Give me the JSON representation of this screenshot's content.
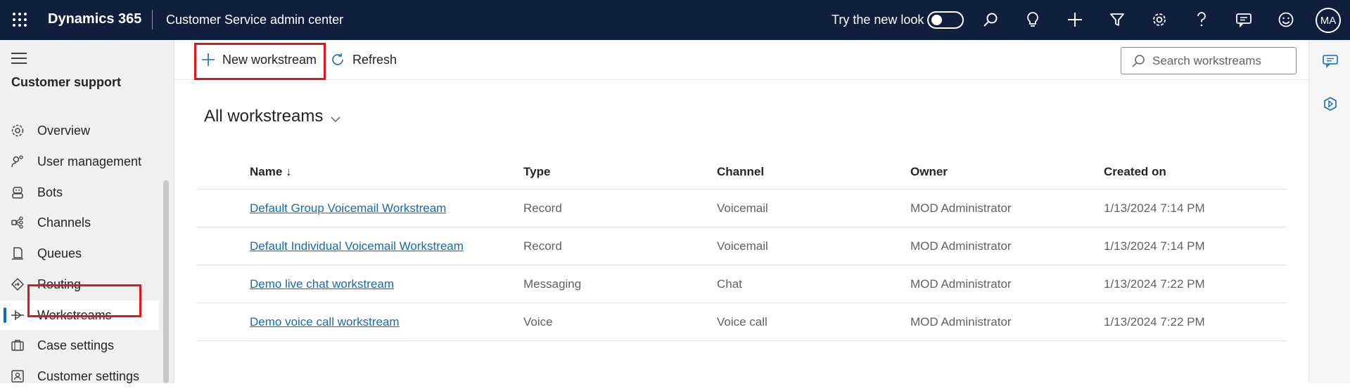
{
  "topbar": {
    "brand": "Dynamics 365",
    "app_title": "Customer Service admin center",
    "try_new_look": "Try the new look",
    "avatar_initials": "MA",
    "background": "#0f1f3d"
  },
  "sidebar": {
    "section_title": "Customer support",
    "items": [
      {
        "label": "Overview",
        "icon": "overview-icon"
      },
      {
        "label": "User management",
        "icon": "user-management-icon"
      },
      {
        "label": "Bots",
        "icon": "bot-icon"
      },
      {
        "label": "Channels",
        "icon": "channels-icon"
      },
      {
        "label": "Queues",
        "icon": "queues-icon"
      },
      {
        "label": "Routing",
        "icon": "routing-icon"
      },
      {
        "label": "Workstreams",
        "icon": "workstreams-icon",
        "selected": true
      },
      {
        "label": "Case settings",
        "icon": "case-settings-icon"
      },
      {
        "label": "Customer settings",
        "icon": "customer-settings-icon"
      }
    ]
  },
  "commandbar": {
    "new_label": "New workstream",
    "refresh_label": "Refresh",
    "search_placeholder": "Search workstreams"
  },
  "view": {
    "title": "All workstreams"
  },
  "grid": {
    "columns": [
      "Name ↓",
      "Type",
      "Channel",
      "Owner",
      "Created on"
    ],
    "rows": [
      {
        "name": "Default Group Voicemail Workstream",
        "type": "Record",
        "channel": "Voicemail",
        "owner": "MOD Administrator",
        "created": "1/13/2024 7:14 PM"
      },
      {
        "name": "Default Individual Voicemail Workstream",
        "type": "Record",
        "channel": "Voicemail",
        "owner": "MOD Administrator",
        "created": "1/13/2024 7:14 PM"
      },
      {
        "name": "Demo live chat workstream",
        "type": "Messaging",
        "channel": "Chat",
        "owner": "MOD Administrator",
        "created": "1/13/2024 7:22 PM"
      },
      {
        "name": "Demo voice call workstream",
        "type": "Voice",
        "channel": "Voice call",
        "owner": "MOD Administrator",
        "created": "1/13/2024 7:22 PM"
      }
    ]
  },
  "colors": {
    "accent": "#0f6cbd",
    "highlight": "#e0161f"
  }
}
